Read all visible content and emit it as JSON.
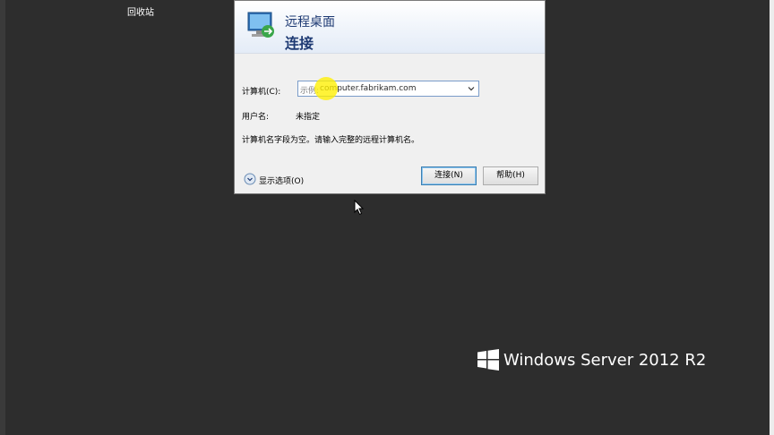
{
  "desktop": {
    "recycle_bin_label": "回收站",
    "brand_text": "Windows Server 2012 R2"
  },
  "dialog": {
    "title": "远程桌面",
    "subtitle": "连接",
    "computer_label": "计算机(C):",
    "computer_input": {
      "placeholder": "示例:",
      "value": "computer.fabrikam.com"
    },
    "username_label": "用户名:",
    "username_value": "未指定",
    "message": "计算机名字段为空。请输入完整的远程计算机名。",
    "show_options_label": "显示选项(O)",
    "connect_button": "连接(N)",
    "help_button": "帮助(H)"
  },
  "icons": [
    "recycle-bin-icon",
    "remote-desktop-icon",
    "dropdown-arrow-icon",
    "expand-options-icon",
    "windows-logo-icon",
    "mouse-cursor-icon"
  ],
  "colors": {
    "desktop": "#2d2d2d",
    "title_text": "#1e3a73",
    "dialog_bg": "#f0f0f0",
    "highlight": "#fff000"
  }
}
